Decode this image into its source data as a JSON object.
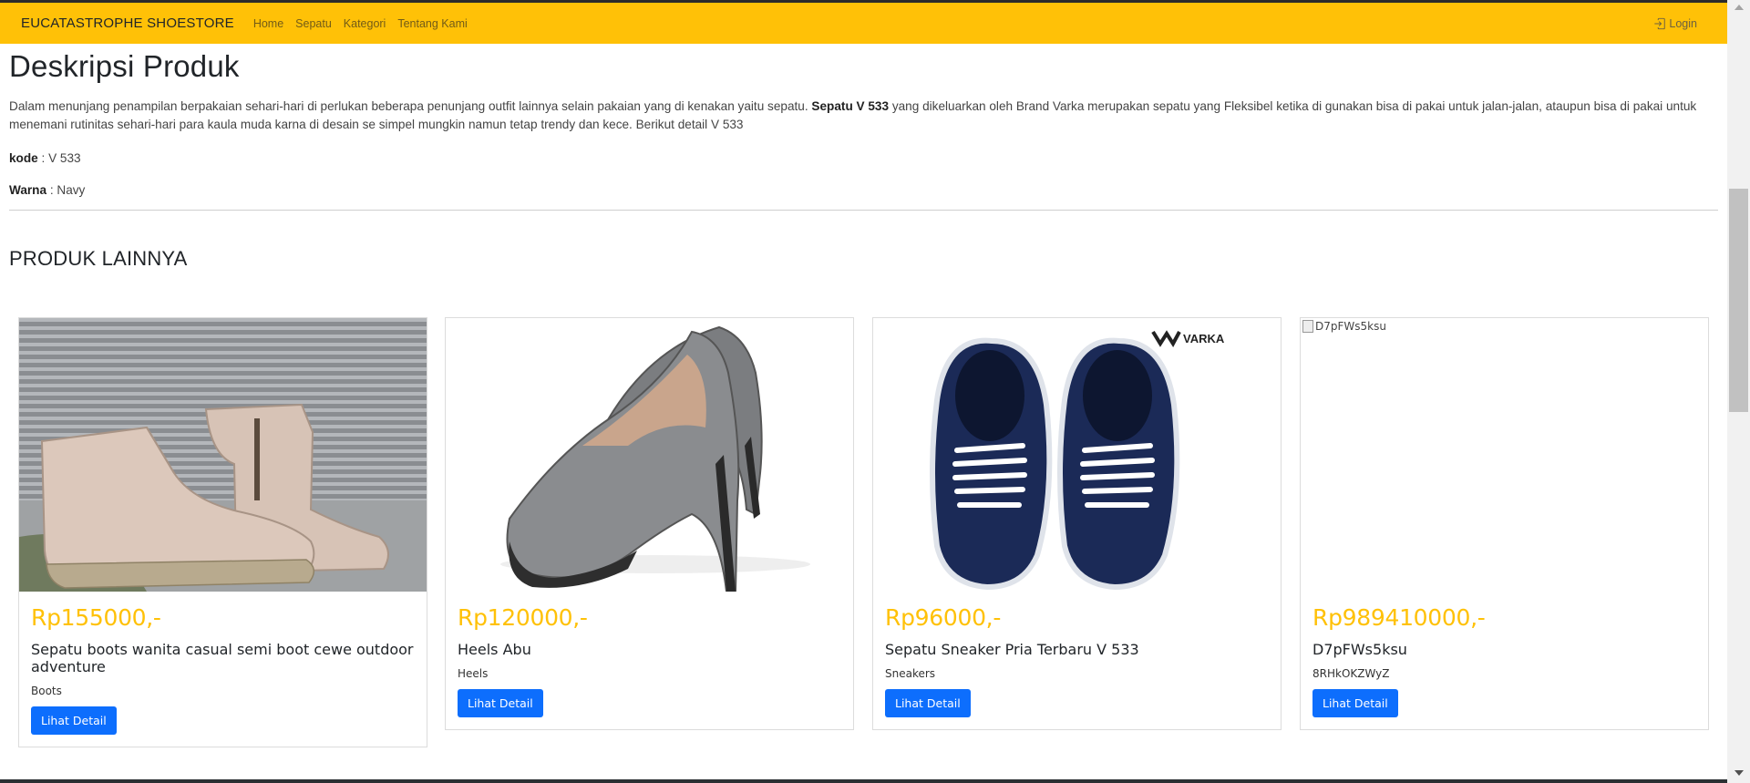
{
  "navbar": {
    "brand": "EUCATASTROPHE SHOESTORE",
    "links": [
      "Home",
      "Sepatu",
      "Kategori",
      "Tentang Kami"
    ],
    "login_label": "Login",
    "login_icon": "login-icon",
    "background": "#ffc107"
  },
  "description": {
    "heading": "Deskripsi Produk",
    "text_before": "Dalam menunjang penampilan berpakaian sehari-hari di perlukan beberapa penunjang outfit lainnya selain pakaian yang di kenakan yaitu sepatu. ",
    "text_bold": "Sepatu V 533",
    "text_after": " yang dikeluarkan oleh Brand Varka merupakan sepatu yang Fleksibel ketika di gunakan bisa di pakai untuk jalan-jalan, ataupun bisa di pakai untuk menemani rutinitas sehari-hari para kaula muda karna di desain se simpel mungkin namun tetap trendy dan kece. Berikut detail V 533",
    "specs": [
      {
        "label": "kode",
        "value": " : V 533"
      },
      {
        "label": "Warna",
        "value": " : Navy"
      }
    ]
  },
  "other_products": {
    "heading": "PRODUK LAINNYA",
    "button_label": "Lihat Detail",
    "items": [
      {
        "price": "Rp155000,-",
        "name": "Sepatu boots wanita casual semi boot cewe outdoor adventure",
        "category": "Boots",
        "image": "boots-photo"
      },
      {
        "price": "Rp120000,-",
        "name": "Heels Abu",
        "category": "Heels",
        "image": "heels-photo"
      },
      {
        "price": "Rp96000,-",
        "name": "Sepatu Sneaker Pria Terbaru V 533",
        "category": "Sneakers",
        "image": "sneaker-photo",
        "brand_mark": "VARKA"
      },
      {
        "price": "Rp989410000,-",
        "name": "D7pFWs5ksu",
        "category": "8RHkOKZWyZ",
        "image": "broken-image",
        "alt": "D7pFWs5ksu"
      }
    ]
  },
  "colors": {
    "accent": "#ffc107",
    "button": "#0d6efd"
  }
}
